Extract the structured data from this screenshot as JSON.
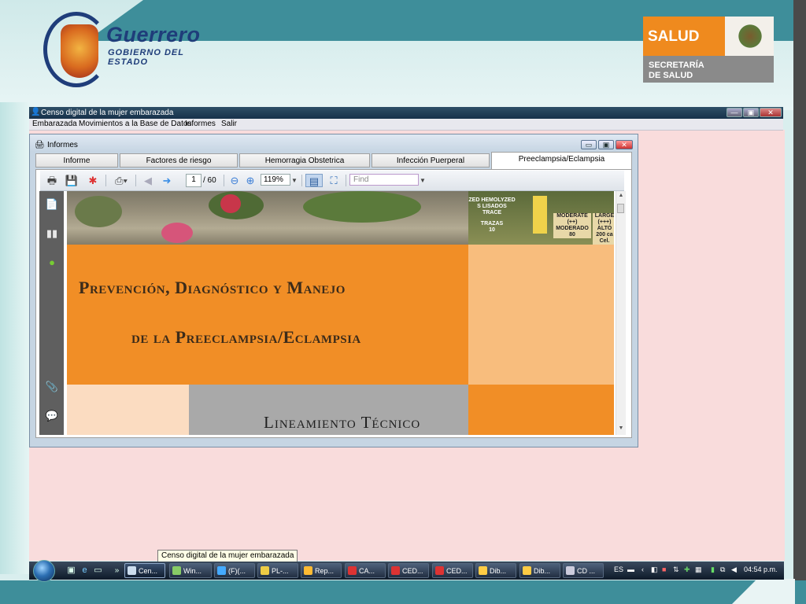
{
  "header": {
    "state_logo": {
      "name": "Guerrero",
      "subtitle": "GOBIERNO DEL ESTADO"
    },
    "salud_logo": {
      "title": "SALUD",
      "line1": "SECRETARÍA",
      "line2": "DE SALUD"
    }
  },
  "app": {
    "title": "Censo digital de la mujer embarazada",
    "menu": [
      "Embarazada",
      "Movimientos a la Base de Datos",
      "Informes",
      "Salir"
    ],
    "window_buttons": {
      "minimize": "—",
      "maximize": "▣",
      "close": "✕"
    }
  },
  "child_window": {
    "title": "Informes",
    "tabs": [
      {
        "label": "Informe",
        "active": false
      },
      {
        "label": "Factores de riesgo",
        "active": false
      },
      {
        "label": "Hemorragia Obstetrica",
        "active": false
      },
      {
        "label": "Infección Puerperal",
        "active": false
      },
      {
        "label": "Preeclampsia/Eclampsia",
        "active": true
      }
    ],
    "window_buttons": {
      "minimize": "▭",
      "maximize": "▣",
      "close": "✕"
    }
  },
  "pdf_viewer": {
    "page": "1",
    "page_total": "/ 60",
    "zoom": "119%",
    "find_placeholder": "Find",
    "document": {
      "title_line1": "Prevención, Diagnóstico y Manejo",
      "title_line2": "de la Preeclampsia/Eclampsia",
      "subtitle": "Lineamiento Técnico",
      "photo_labels": {
        "col1": "ZED HEMOLYZED",
        "col1b": "S LISADOS",
        "col1c": "TRACE",
        "col1d": "TRAZAS",
        "col1e": "10",
        "col2": "MODERATE",
        "col2b": "(++)",
        "col2c": "MODERADO",
        "col2d": "80",
        "col3": "LARGE",
        "col3b": "(+++)",
        "col3c": "ALTO",
        "col3d": "200 ca Cel."
      }
    }
  },
  "tooltip": "Censo digital de la mujer embarazada",
  "taskbar": {
    "tasks": [
      "Cen...",
      "Win...",
      "(F)(...",
      "PL-...",
      "Rep...",
      "CA...",
      "CED...",
      "CED...",
      "Dib...",
      "Dib...",
      "CD ..."
    ],
    "overflow": "»",
    "tray": {
      "language": "ES",
      "time": "04:54 p.m."
    }
  },
  "colors": {
    "orange": "#f18e26",
    "teal": "#3e8e9a",
    "navy": "#1f3d7a",
    "desktop": "#f9dcdc"
  }
}
